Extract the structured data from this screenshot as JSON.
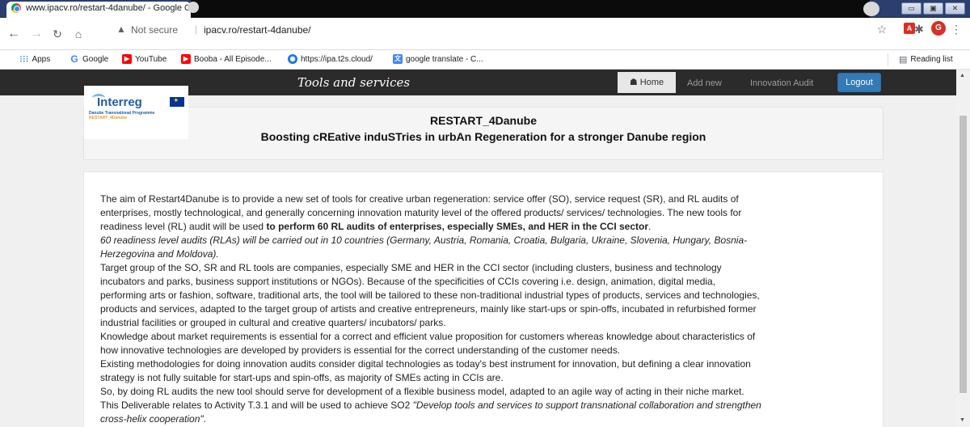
{
  "browser": {
    "window_title": "www.ipacv.ro/restart-4danube/ - Google Chrome",
    "not_secure": "Not secure",
    "url": "ipacv.ro/restart-4danube/",
    "profile_initial": "G",
    "window_controls": [
      "▭",
      "▣",
      "✕"
    ]
  },
  "bookmarks": {
    "items": [
      "Apps",
      "Google",
      "YouTube",
      "Booba - All Episode...",
      "https://ipa.t2s.cloud/",
      "google translate - C..."
    ],
    "reading_list": "Reading list"
  },
  "site": {
    "nav_title": "Tools and services",
    "nav_home": "Home",
    "nav_add_new": "Add new",
    "nav_innovation_audit": "Innovation Audit",
    "nav_logout": "Logout",
    "logo_brand": "Interreg",
    "logo_sub1": "Danube Transnational Programme",
    "logo_sub2": "RESTART_4Danube",
    "header_title": "RESTART_4Danube",
    "header_subtitle": "Boosting cREative induSTries in urbAn Regeneration for a stronger Danube region"
  },
  "content": {
    "p1_a": "The aim of Restart4Danube is to provide a new set of tools for creative urban regeneration: service offer (SO), service request (SR), and RL audits of",
    "p1_b": "enterprises, mostly technological, and generally concerning innovation maturity level of the offered products/ services/ technologies. The new tools for",
    "p1_c": "readiness level (RL) audit will be used ",
    "p1_c_bold": "to perform 60 RL audits of enterprises, especially SMEs, and HER in the CCI sector",
    "p1_c_end": ".",
    "p2_a": "60 readiness level audits (RLAs) will be carried out in 10 countries (Germany, Austria, Romania, Croatia, Bulgaria, Ukraine, Slovenia, Hungary, Bosnia-",
    "p2_b": "Herzegovina and Moldova).",
    "p3_a": "Target group of the SO, SR and RL tools are companies, especially SME and HER in the CCI sector (including clusters, business and technology",
    "p3_b": "incubators and parks, business support institutions or NGOs). Because of the specificities of CCIs covering i.e. design, animation, digital media,",
    "p3_c": "performing arts or fashion, software, traditional arts, the tool will be tailored to these non-traditional industrial types of products, services and technologies,",
    "p3_d": "products and services, adapted to the target group of artists and creative entrepreneurs, mainly like start-ups or spin-offs, incubated in refurbished former",
    "p3_e": "industrial facilities or grouped in cultural and creative quarters/ incubators/ parks.",
    "p4_a": "Knowledge about market requirements is essential for a correct and efficient value proposition for customers whereas knowledge about characteristics of",
    "p4_b": "how innovative technologies are developed by providers is essential for the correct understanding of the customer needs.",
    "p5_a": "Existing methodologies for doing innovation audits consider digital technologies as today's best instrument for innovation, but defining a clear innovation",
    "p5_b": "strategy is not fully suitable for start-ups and spin-offs, as majority of SMEs acting in CCIs are.",
    "p6": "So, by doing RL audits the new tool should serve for development of a flexible business model, adapted to an agile way of acting in their niche market.",
    "p7_a": "This Deliverable relates to Activity T.3.1 and will be used to achieve SO2 ",
    "p7_a_italic": "\"Develop tools and services to support transnational collaboration and strengthen",
    "p7_b_italic": "cross-helix cooperation\"",
    "p7_b_end": "."
  }
}
